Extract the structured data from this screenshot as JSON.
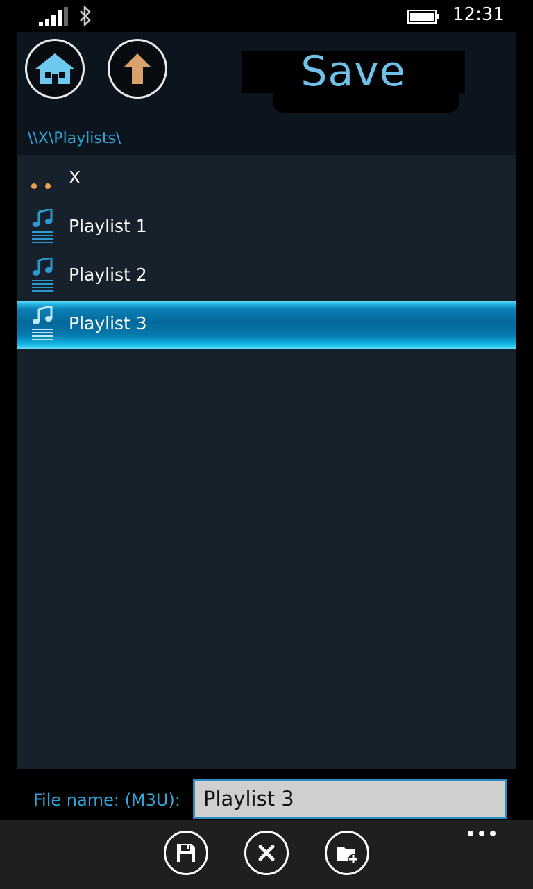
{
  "status_bar": {
    "time": "12:31"
  },
  "header": {
    "title": "Save",
    "path": "\\\\X\\Playlists\\"
  },
  "list": {
    "items": [
      {
        "label": "X",
        "icon": "parent-dots-icon"
      },
      {
        "label": "Playlist 1",
        "icon": "playlist-icon"
      },
      {
        "label": "Playlist 2",
        "icon": "playlist-icon"
      },
      {
        "label": "Playlist 3",
        "icon": "playlist-icon",
        "selected": true
      }
    ]
  },
  "footer": {
    "file_name_label": "File name: (M3U):",
    "file_name_value": "Playlist 3"
  },
  "app_bar": {
    "buttons": [
      "save-icon",
      "cancel-icon",
      "new-folder-icon"
    ],
    "more": "more-icon"
  },
  "colors": {
    "accent": "#2ea7d8",
    "title": "#6ec1e8",
    "list_bg": "#17212b",
    "up_arrow": "#d9a26a"
  }
}
